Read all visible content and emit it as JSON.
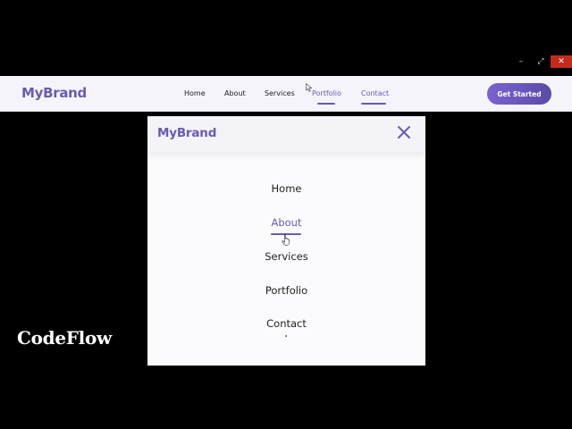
{
  "window": {
    "minimize_glyph": "–",
    "maximize_glyph": "⤢",
    "close_glyph": "✕"
  },
  "navbar": {
    "brand": "MyBrand",
    "links": [
      {
        "label": "Home",
        "active": false
      },
      {
        "label": "About",
        "active": false
      },
      {
        "label": "Services",
        "active": false
      },
      {
        "label": "Portfolio",
        "active": true
      },
      {
        "label": "Contact",
        "active": true
      }
    ],
    "cta_label": "Get Started"
  },
  "mobile_menu": {
    "brand": "MyBrand",
    "close_icon": "close-x-icon",
    "items": [
      {
        "label": "Home",
        "active": false
      },
      {
        "label": "About",
        "active": true
      },
      {
        "label": "Services",
        "active": false
      },
      {
        "label": "Portfolio",
        "active": false
      },
      {
        "label": "Contact",
        "active": false
      }
    ]
  },
  "watermark": "CodeFlow",
  "colors": {
    "accent": "#6a5bb0",
    "cta_start": "#7a62d0",
    "cta_end": "#5c4aa8",
    "close_red": "#c42b1c"
  }
}
